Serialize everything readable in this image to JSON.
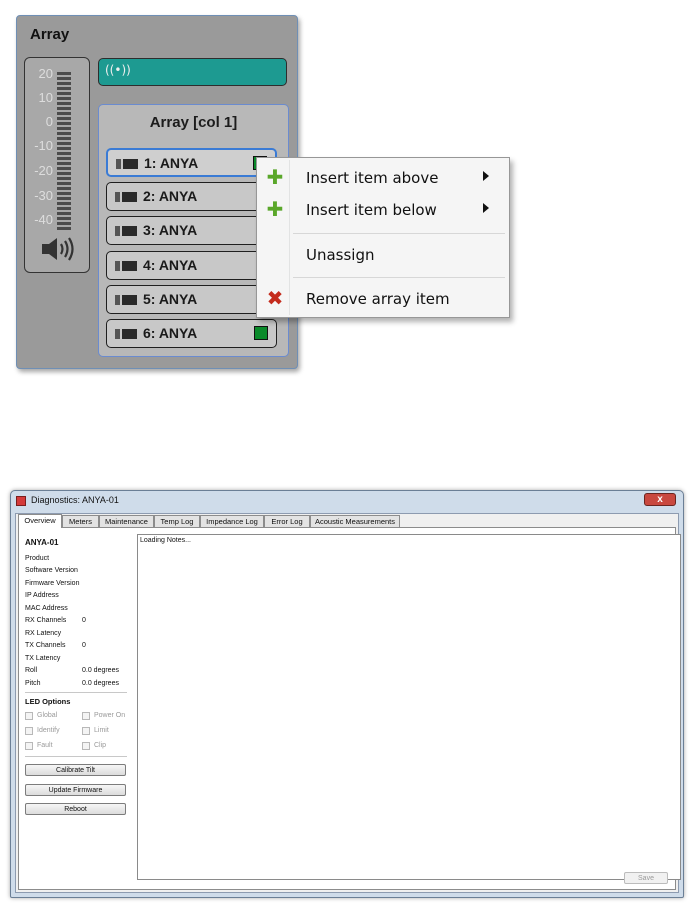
{
  "array_panel": {
    "title": "Array",
    "meter": {
      "labels": [
        "20",
        "10",
        "0",
        "-10",
        "-20",
        "-30",
        "-40"
      ]
    },
    "link_icon": "((•))",
    "column": {
      "title": "Array [col 1]",
      "items": [
        {
          "label": "1: ANYA",
          "selected": true
        },
        {
          "label": "2: ANYA"
        },
        {
          "label": "3: ANYA"
        },
        {
          "label": "4: ANYA"
        },
        {
          "label": "5: ANYA"
        },
        {
          "label": "6: ANYA"
        }
      ]
    },
    "colors": {
      "accent": "#1d9a91",
      "led": "#0a8a2a",
      "selection": "#3a7bd5"
    }
  },
  "context_menu": {
    "items": [
      {
        "label": "Insert item above",
        "icon": "plus-icon",
        "submenu": true
      },
      {
        "label": "Insert item below",
        "icon": "plus-icon",
        "submenu": true
      },
      {
        "label": "Unassign"
      },
      {
        "label": "Remove array item",
        "icon": "x-icon"
      }
    ]
  },
  "diagnostics": {
    "title": "Diagnostics: ANYA-01",
    "close_label": "x",
    "tabs": [
      "Overview",
      "Meters",
      "Maintenance",
      "Temp Log",
      "Impedance Log",
      "Error Log",
      "Acoustic Measurements"
    ],
    "device_name": "ANYA-01",
    "info": [
      {
        "label": "Product",
        "value": ""
      },
      {
        "label": "Software Version",
        "value": ""
      },
      {
        "label": "Firmware Version",
        "value": ""
      },
      {
        "label": "IP Address",
        "value": ""
      },
      {
        "label": "MAC Address",
        "value": ""
      },
      {
        "label": "RX Channels",
        "value": "0"
      },
      {
        "label": "RX Latency",
        "value": ""
      },
      {
        "label": "TX Channels",
        "value": "0"
      },
      {
        "label": "TX Latency",
        "value": ""
      },
      {
        "label": "Roll",
        "value": "0.0 degrees"
      },
      {
        "label": "Pitch",
        "value": "0.0 degrees"
      }
    ],
    "led_options": {
      "title": "LED Options",
      "options": [
        "Global",
        "Power On",
        "Identify",
        "Limit",
        "Fault",
        "Clip"
      ]
    },
    "buttons": [
      "Calibrate Tilt",
      "Update Firmware",
      "Reboot"
    ],
    "notes_text": "Loading Notes...",
    "save_label": "Save"
  }
}
